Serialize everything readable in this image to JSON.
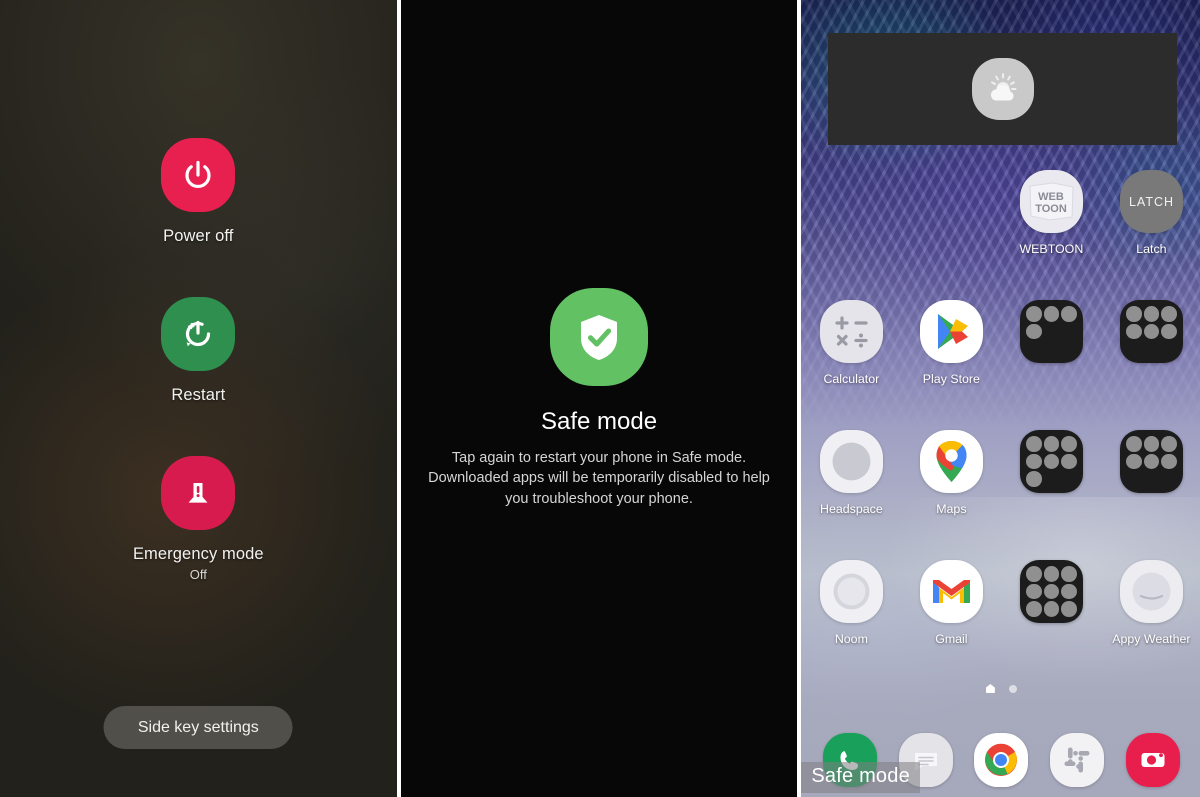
{
  "panels": {
    "power_menu": {
      "name": "power-menu",
      "items": [
        {
          "label": "Power off",
          "sub": "",
          "icon": "power-icon",
          "color": "#e8204f"
        },
        {
          "label": "Restart",
          "sub": "",
          "icon": "restart-icon",
          "color": "#2f8f4e"
        },
        {
          "label": "Emergency mode",
          "sub": "Off",
          "icon": "emergency-icon",
          "color": "#d81b4e"
        }
      ],
      "side_key_button": "Side key settings"
    },
    "safe_mode_dialog": {
      "title": "Safe mode",
      "description": "Tap again to restart your phone in Safe mode. Downloaded apps will be temporarily disabled to help you troubleshoot your phone.",
      "icon": "shield-check-icon",
      "icon_color": "#61c163"
    },
    "home_screen": {
      "widget": {
        "name": "weather-widget",
        "icon": "weather-partly-cloudy-icon",
        "disabled": true
      },
      "rows": [
        [
          {
            "type": "empty",
            "label": ""
          },
          {
            "type": "empty",
            "label": ""
          },
          {
            "type": "app",
            "label": "WEBTOON",
            "icon": "webtoon-icon"
          },
          {
            "type": "app",
            "label": "Latch",
            "icon": "latch-icon"
          }
        ],
        [
          {
            "type": "app",
            "label": "Calculator",
            "icon": "calculator-icon"
          },
          {
            "type": "app",
            "label": "Play Store",
            "icon": "play-store-icon"
          },
          {
            "type": "folder",
            "label": "",
            "icon": "app-folder-icon",
            "count": 4
          },
          {
            "type": "folder",
            "label": "",
            "icon": "app-folder-icon",
            "count": 6
          }
        ],
        [
          {
            "type": "app",
            "label": "Headspace",
            "icon": "headspace-icon"
          },
          {
            "type": "app",
            "label": "Maps",
            "icon": "google-maps-icon"
          },
          {
            "type": "folder",
            "label": "",
            "icon": "app-folder-icon",
            "count": 7
          },
          {
            "type": "folder",
            "label": "",
            "icon": "app-folder-icon",
            "count": 6
          }
        ],
        [
          {
            "type": "app",
            "label": "Noom",
            "icon": "noom-icon"
          },
          {
            "type": "app",
            "label": "Gmail",
            "icon": "gmail-icon"
          },
          {
            "type": "folder",
            "label": "",
            "icon": "app-folder-icon",
            "count": 9
          },
          {
            "type": "app",
            "label": "Appy Weather",
            "icon": "appy-weather-icon"
          }
        ]
      ],
      "page_indicator": {
        "pages": 2,
        "active": 0
      },
      "dock": [
        {
          "label": "Phone",
          "icon": "phone-icon"
        },
        {
          "label": "Messages",
          "icon": "messages-icon"
        },
        {
          "label": "Chrome",
          "icon": "chrome-icon"
        },
        {
          "label": "Slack",
          "icon": "slack-icon"
        },
        {
          "label": "Camera",
          "icon": "camera-icon"
        }
      ],
      "safe_mode_badge": "Safe mode"
    }
  }
}
